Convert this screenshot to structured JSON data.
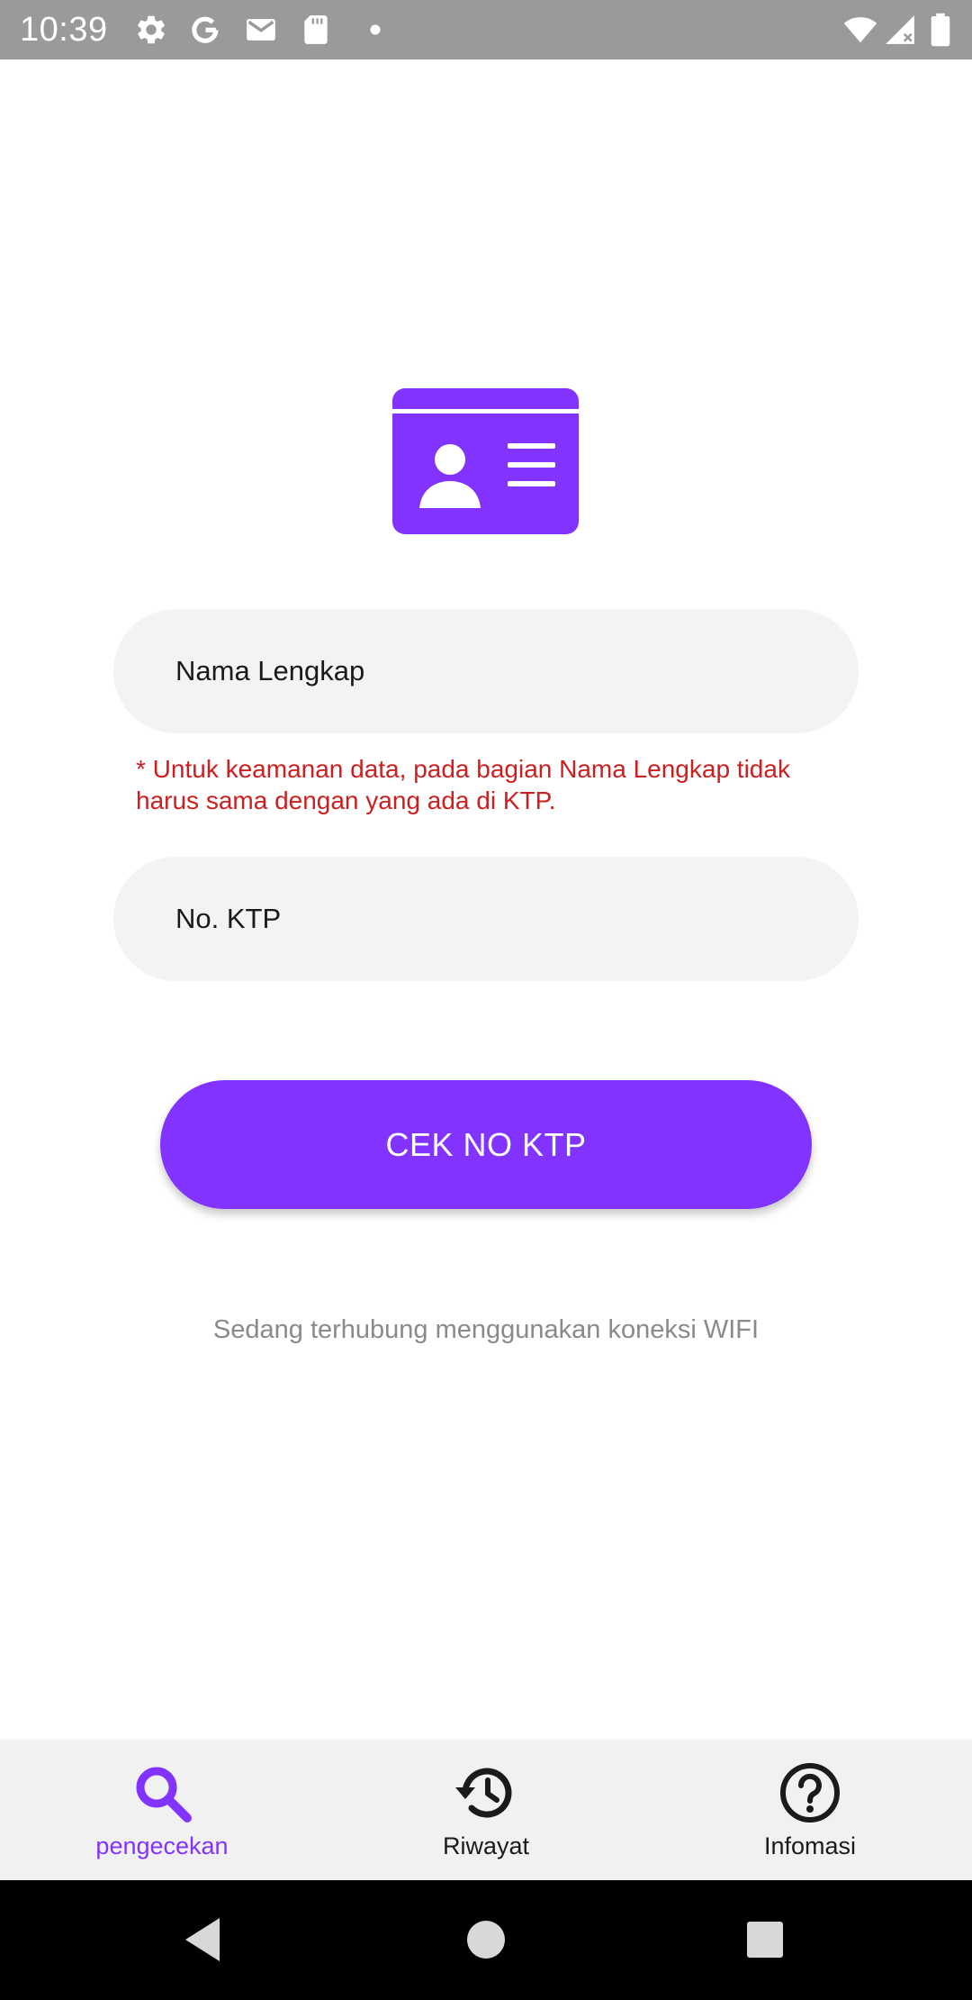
{
  "status_bar": {
    "time": "10:39",
    "left_icons": [
      "settings-icon",
      "google-icon",
      "gmail-icon",
      "sd-card-icon",
      "notification-dot-icon"
    ],
    "right_icons": [
      "wifi-icon",
      "cell-signal-icon",
      "battery-icon"
    ]
  },
  "main": {
    "header_icon": "id-card-icon",
    "name_field": {
      "placeholder": "Nama Lengkap",
      "value": ""
    },
    "warning": "* Untuk keamanan data, pada bagian Nama Lengkap tidak harus sama dengan yang ada di KTP.",
    "ktp_field": {
      "placeholder": "No. KTP",
      "value": ""
    },
    "check_button_label": "CEK NO KTP",
    "connection_status": "Sedang terhubung menggunakan koneksi WIFI"
  },
  "bottom_nav": {
    "items": [
      {
        "label": "pengecekan",
        "icon": "search-icon",
        "active": true
      },
      {
        "label": "Riwayat",
        "icon": "history-icon",
        "active": false
      },
      {
        "label": "Infomasi",
        "icon": "help-circle-icon",
        "active": false
      }
    ]
  },
  "system_nav": {
    "buttons": [
      "back-icon",
      "home-icon",
      "recents-icon"
    ]
  },
  "colors": {
    "accent": "#8333ff",
    "warning": "#cc2020",
    "status_bar": "#9a9a9a",
    "input_bg": "#f3f3f3",
    "nav_bg": "#f1f1f1",
    "muted_text": "#8a8a8a"
  }
}
